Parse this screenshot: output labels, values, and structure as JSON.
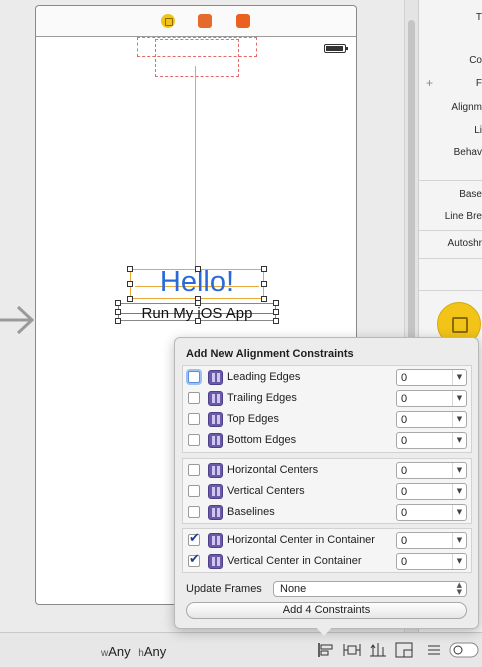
{
  "scene": {
    "hello_text": "Hello!",
    "run_text": "Run My iOS App"
  },
  "bottom_bar": {
    "w_prefix": "w",
    "w_value": "Any",
    "h_prefix": "h",
    "h_value": "Any"
  },
  "inspector": {
    "labels": [
      "T",
      "Co",
      "F",
      "Alignm",
      "Li",
      "Behav",
      "Base",
      "Line Bre",
      "Autoshr"
    ]
  },
  "popover": {
    "title": "Add New Alignment Constraints",
    "groups": [
      [
        {
          "label": "Leading Edges",
          "checked": false,
          "value": "0"
        },
        {
          "label": "Trailing Edges",
          "checked": false,
          "value": "0"
        },
        {
          "label": "Top Edges",
          "checked": false,
          "value": "0"
        },
        {
          "label": "Bottom Edges",
          "checked": false,
          "value": "0"
        }
      ],
      [
        {
          "label": "Horizontal Centers",
          "checked": false,
          "value": "0"
        },
        {
          "label": "Vertical Centers",
          "checked": false,
          "value": "0"
        },
        {
          "label": "Baselines",
          "checked": false,
          "value": "0"
        }
      ],
      [
        {
          "label": "Horizontal Center in Container",
          "checked": true,
          "value": "0"
        },
        {
          "label": "Vertical Center in Container",
          "checked": true,
          "value": "0"
        }
      ]
    ],
    "update_frames_label": "Update Frames",
    "update_frames_value": "None",
    "add_button_label": "Add 4 Constraints"
  },
  "colors": {
    "accent_blue": "#2a6ad8",
    "constraint_orange": "#e8a93a",
    "constraint_red": "#e05050"
  }
}
